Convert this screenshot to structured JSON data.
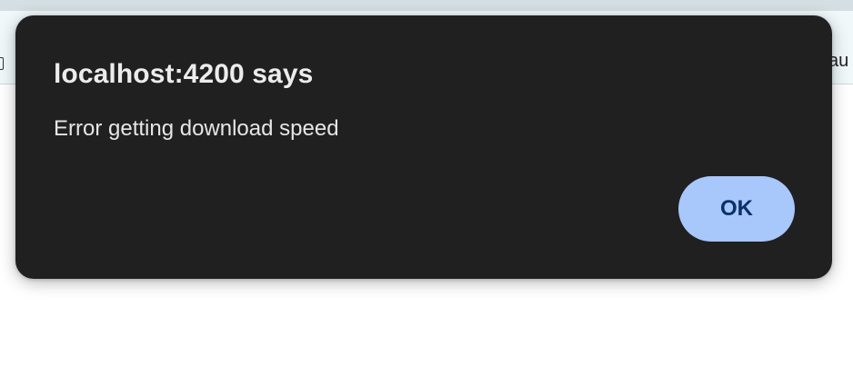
{
  "browser": {
    "right_text": "au",
    "left_icon": "tab-icon"
  },
  "dialog": {
    "title": "localhost:4200 says",
    "message": "Error getting download speed",
    "ok_label": "OK",
    "colors": {
      "background": "#202020",
      "button": "#a8c7fa",
      "button_text": "#0a2f6b"
    }
  }
}
